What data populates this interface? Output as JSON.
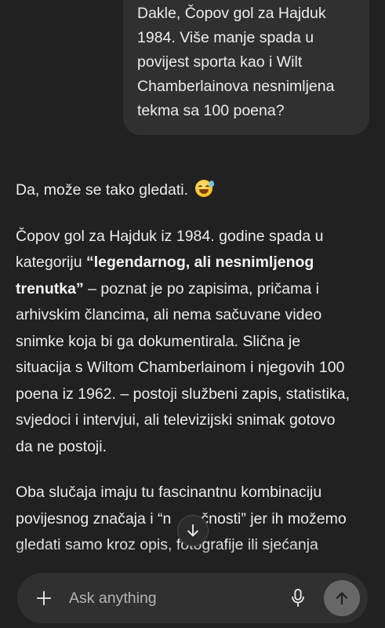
{
  "user_message": {
    "lines": [
      "Dakle, Čopov gol za Hajduk",
      "1984. Više manje spada u",
      "povijest sporta kao i Wilt",
      "Chamberlainova nesnimljena",
      "tekma sa 100 poena?"
    ]
  },
  "assistant_message": {
    "p1": "Da, može se tako gledati.",
    "emoji": "sweat-smile-emoji",
    "p2": {
      "l1": "Čopov gol za Hajduk iz 1984. godine spada u",
      "l2": "kategoriju ",
      "l2_bold": "“legendarnog, ali nesnimljenog",
      "l3_bold": "trenutka”",
      "l3": " – poznat je po zapisima, pričama i",
      "l4": "arhivskim člancima, ali nema sačuvane video",
      "l5": "snimke koja bi ga dokumentirala. Slična je",
      "l6": "situacija s Wiltom Chamberlainom i njegovih 100",
      "l7": "poena iz 1962. – postoji službeni zapis, statistika,",
      "l8": "svjedoci i intervjui, ali televizijski snimak gotovo",
      "l9": "da ne postoji."
    },
    "p3": {
      "l1": "Oba slučaja imaju tu fascinantnu kombinaciju",
      "l2a": "povijesnog značaja i “n",
      "l2b": "čnosti” jer ih možemo",
      "l3": "gledati samo kroz opis, fotografije ili sjećanja"
    }
  },
  "composer": {
    "placeholder": "Ask anything",
    "icons": {
      "plus": "plus-icon",
      "mic": "microphone-icon",
      "send": "arrow-up-icon",
      "scroll": "arrow-down-icon"
    }
  },
  "colors": {
    "background": "#212121",
    "bubble": "#303030",
    "text": "#ececec",
    "placeholder": "#b4b4b4",
    "send_button": "#676767"
  }
}
